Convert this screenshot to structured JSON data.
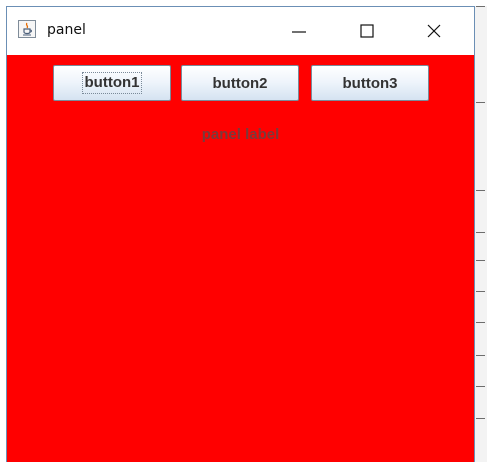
{
  "window": {
    "title": "panel",
    "controls": {
      "minimize_icon": "minimize-icon",
      "maximize_icon": "maximize-icon",
      "close_icon": "close-icon"
    }
  },
  "panel": {
    "background_color": "#ff0000",
    "buttons": [
      {
        "label": "button1",
        "focused": true
      },
      {
        "label": "button2",
        "focused": false
      },
      {
        "label": "button3",
        "focused": false
      }
    ],
    "label": "panel label"
  }
}
